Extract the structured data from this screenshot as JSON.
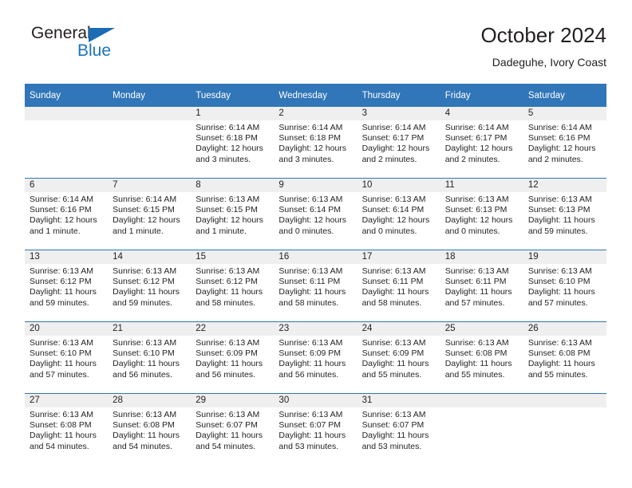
{
  "brand": {
    "name_part1": "General",
    "name_part2": "Blue",
    "triangle_color": "#1b6cb5",
    "blue_color": "#1b75bb"
  },
  "header": {
    "title": "October 2024",
    "subtitle": "Dadeguhe, Ivory Coast"
  },
  "theme": {
    "header_bg": "#3076b8",
    "header_text": "#ffffff",
    "daynum_band_bg": "#efefef",
    "cell_bg": "#ffffff",
    "text": "#231f20"
  },
  "weekdays": [
    "Sunday",
    "Monday",
    "Tuesday",
    "Wednesday",
    "Thursday",
    "Friday",
    "Saturday"
  ],
  "weeks": [
    [
      {
        "day": "",
        "lines": []
      },
      {
        "day": "",
        "lines": []
      },
      {
        "day": "1",
        "lines": [
          "Sunrise: 6:14 AM",
          "Sunset: 6:18 PM",
          "Daylight: 12 hours",
          "and 3 minutes."
        ]
      },
      {
        "day": "2",
        "lines": [
          "Sunrise: 6:14 AM",
          "Sunset: 6:18 PM",
          "Daylight: 12 hours",
          "and 3 minutes."
        ]
      },
      {
        "day": "3",
        "lines": [
          "Sunrise: 6:14 AM",
          "Sunset: 6:17 PM",
          "Daylight: 12 hours",
          "and 2 minutes."
        ]
      },
      {
        "day": "4",
        "lines": [
          "Sunrise: 6:14 AM",
          "Sunset: 6:17 PM",
          "Daylight: 12 hours",
          "and 2 minutes."
        ]
      },
      {
        "day": "5",
        "lines": [
          "Sunrise: 6:14 AM",
          "Sunset: 6:16 PM",
          "Daylight: 12 hours",
          "and 2 minutes."
        ]
      }
    ],
    [
      {
        "day": "6",
        "lines": [
          "Sunrise: 6:14 AM",
          "Sunset: 6:16 PM",
          "Daylight: 12 hours",
          "and 1 minute."
        ]
      },
      {
        "day": "7",
        "lines": [
          "Sunrise: 6:14 AM",
          "Sunset: 6:15 PM",
          "Daylight: 12 hours",
          "and 1 minute."
        ]
      },
      {
        "day": "8",
        "lines": [
          "Sunrise: 6:13 AM",
          "Sunset: 6:15 PM",
          "Daylight: 12 hours",
          "and 1 minute."
        ]
      },
      {
        "day": "9",
        "lines": [
          "Sunrise: 6:13 AM",
          "Sunset: 6:14 PM",
          "Daylight: 12 hours",
          "and 0 minutes."
        ]
      },
      {
        "day": "10",
        "lines": [
          "Sunrise: 6:13 AM",
          "Sunset: 6:14 PM",
          "Daylight: 12 hours",
          "and 0 minutes."
        ]
      },
      {
        "day": "11",
        "lines": [
          "Sunrise: 6:13 AM",
          "Sunset: 6:13 PM",
          "Daylight: 12 hours",
          "and 0 minutes."
        ]
      },
      {
        "day": "12",
        "lines": [
          "Sunrise: 6:13 AM",
          "Sunset: 6:13 PM",
          "Daylight: 11 hours",
          "and 59 minutes."
        ]
      }
    ],
    [
      {
        "day": "13",
        "lines": [
          "Sunrise: 6:13 AM",
          "Sunset: 6:12 PM",
          "Daylight: 11 hours",
          "and 59 minutes."
        ]
      },
      {
        "day": "14",
        "lines": [
          "Sunrise: 6:13 AM",
          "Sunset: 6:12 PM",
          "Daylight: 11 hours",
          "and 59 minutes."
        ]
      },
      {
        "day": "15",
        "lines": [
          "Sunrise: 6:13 AM",
          "Sunset: 6:12 PM",
          "Daylight: 11 hours",
          "and 58 minutes."
        ]
      },
      {
        "day": "16",
        "lines": [
          "Sunrise: 6:13 AM",
          "Sunset: 6:11 PM",
          "Daylight: 11 hours",
          "and 58 minutes."
        ]
      },
      {
        "day": "17",
        "lines": [
          "Sunrise: 6:13 AM",
          "Sunset: 6:11 PM",
          "Daylight: 11 hours",
          "and 58 minutes."
        ]
      },
      {
        "day": "18",
        "lines": [
          "Sunrise: 6:13 AM",
          "Sunset: 6:11 PM",
          "Daylight: 11 hours",
          "and 57 minutes."
        ]
      },
      {
        "day": "19",
        "lines": [
          "Sunrise: 6:13 AM",
          "Sunset: 6:10 PM",
          "Daylight: 11 hours",
          "and 57 minutes."
        ]
      }
    ],
    [
      {
        "day": "20",
        "lines": [
          "Sunrise: 6:13 AM",
          "Sunset: 6:10 PM",
          "Daylight: 11 hours",
          "and 57 minutes."
        ]
      },
      {
        "day": "21",
        "lines": [
          "Sunrise: 6:13 AM",
          "Sunset: 6:10 PM",
          "Daylight: 11 hours",
          "and 56 minutes."
        ]
      },
      {
        "day": "22",
        "lines": [
          "Sunrise: 6:13 AM",
          "Sunset: 6:09 PM",
          "Daylight: 11 hours",
          "and 56 minutes."
        ]
      },
      {
        "day": "23",
        "lines": [
          "Sunrise: 6:13 AM",
          "Sunset: 6:09 PM",
          "Daylight: 11 hours",
          "and 56 minutes."
        ]
      },
      {
        "day": "24",
        "lines": [
          "Sunrise: 6:13 AM",
          "Sunset: 6:09 PM",
          "Daylight: 11 hours",
          "and 55 minutes."
        ]
      },
      {
        "day": "25",
        "lines": [
          "Sunrise: 6:13 AM",
          "Sunset: 6:08 PM",
          "Daylight: 11 hours",
          "and 55 minutes."
        ]
      },
      {
        "day": "26",
        "lines": [
          "Sunrise: 6:13 AM",
          "Sunset: 6:08 PM",
          "Daylight: 11 hours",
          "and 55 minutes."
        ]
      }
    ],
    [
      {
        "day": "27",
        "lines": [
          "Sunrise: 6:13 AM",
          "Sunset: 6:08 PM",
          "Daylight: 11 hours",
          "and 54 minutes."
        ]
      },
      {
        "day": "28",
        "lines": [
          "Sunrise: 6:13 AM",
          "Sunset: 6:08 PM",
          "Daylight: 11 hours",
          "and 54 minutes."
        ]
      },
      {
        "day": "29",
        "lines": [
          "Sunrise: 6:13 AM",
          "Sunset: 6:07 PM",
          "Daylight: 11 hours",
          "and 54 minutes."
        ]
      },
      {
        "day": "30",
        "lines": [
          "Sunrise: 6:13 AM",
          "Sunset: 6:07 PM",
          "Daylight: 11 hours",
          "and 53 minutes."
        ]
      },
      {
        "day": "31",
        "lines": [
          "Sunrise: 6:13 AM",
          "Sunset: 6:07 PM",
          "Daylight: 11 hours",
          "and 53 minutes."
        ]
      },
      {
        "day": "",
        "lines": []
      },
      {
        "day": "",
        "lines": []
      }
    ]
  ]
}
